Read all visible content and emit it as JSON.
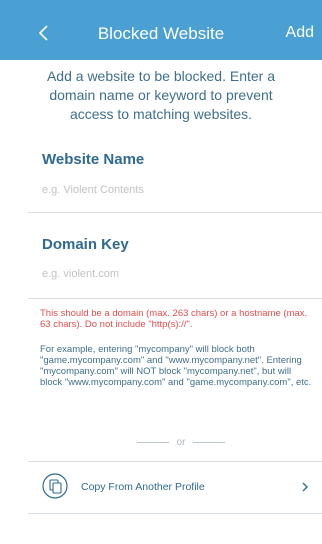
{
  "header": {
    "title": "Blocked Website",
    "add_label": "Add",
    "color": "#4a9fd3"
  },
  "intro": "Add a website to be blocked. Enter a domain name or keyword to prevent access to matching websites.",
  "website_name": {
    "title": "Website Name",
    "placeholder": "e.g. Violent Contents",
    "value": ""
  },
  "domain_key": {
    "title": "Domain Key",
    "placeholder": "e.g. violent.com",
    "value": ""
  },
  "error_text": "This should be a domain (max. 263 chars) or a hostname (max. 63 chars). Do not include \"http(s)://\".",
  "example_text": "For example, entering \"mycompany\" will block both \"game.mycompany.com\" and \"www.mycompany.net\". Entering \"mycompany.com\" will NOT block \"mycompany.net\", but will block \"www.mycompany.com\" and \"game.mycompany.com\", etc.",
  "separator": "or",
  "copy_profile_label": "Copy From Another Profile",
  "icons": {
    "back": "chevron-left-icon",
    "copy": "copy-icon",
    "forward": "chevron-right-icon"
  },
  "colors": {
    "error": "#e14e4e",
    "accent": "#2f6a92"
  }
}
